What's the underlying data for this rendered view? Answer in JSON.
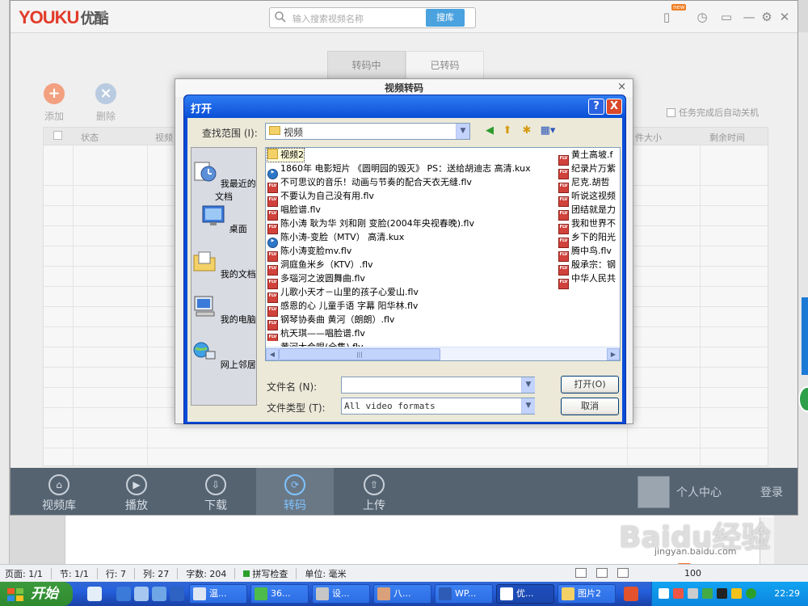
{
  "youku": {
    "logo": "YOUKU",
    "logo_cn": "优酷",
    "search_placeholder": "输入搜索视频名称",
    "search_button": "搜库",
    "tabs": [
      "转码中",
      "已转码"
    ],
    "toolbar": {
      "add": "添加",
      "delete": "删除"
    },
    "shutdown_option": "任务完成后自动关机",
    "table_headers": [
      "状态",
      "视频",
      "件大小",
      "剩余时间"
    ],
    "nav": [
      "视频库",
      "播放",
      "下载",
      "转码",
      "上传"
    ],
    "user_center": "个人中心",
    "login": "登录",
    "badge": "new"
  },
  "transcode_dialog": {
    "title": "视频转码",
    "close": "×"
  },
  "open_dialog": {
    "title": "打开",
    "help": "?",
    "close": "X",
    "lookin_label": "查找范围 (I):",
    "lookin_value": "视频",
    "places": [
      "我最近的文档",
      "桌面",
      "我的文档",
      "我的电脑",
      "网上邻居"
    ],
    "files_col1": [
      {
        "name": "视频2",
        "type": "folder"
      },
      {
        "name": "1860年 电影短片 《圆明园的毁灭》  PS：送给胡迪志 高清.kux",
        "type": "kux"
      },
      {
        "name": "不可思议的音乐！动画与节奏的配合天衣无缝.flv",
        "type": "flv"
      },
      {
        "name": "不要认为自己没有用.flv",
        "type": "flv"
      },
      {
        "name": "唱脸谱.flv",
        "type": "flv"
      },
      {
        "name": "陈小涛 耿为华 刘和刚 变脸(2004年央视春晚).flv",
        "type": "flv"
      },
      {
        "name": "陈小涛-变脸（MTV） 高清.kux",
        "type": "kux"
      },
      {
        "name": "陈小涛变脸mv.flv",
        "type": "flv"
      },
      {
        "name": "洞庭鱼米乡（KTV）.flv",
        "type": "flv"
      },
      {
        "name": "多瑙河之波圆舞曲.flv",
        "type": "flv"
      },
      {
        "name": "儿歌小天才－山里的孩子心爱山.flv",
        "type": "flv"
      },
      {
        "name": "感恩的心 儿童手语 字幕 阳华林.flv",
        "type": "flv"
      },
      {
        "name": "钢琴协奏曲 黄河（朗朗）.flv",
        "type": "flv"
      },
      {
        "name": "杭天琪——唱脸谱.flv",
        "type": "flv"
      },
      {
        "name": "黄河大合唱(全集).flv",
        "type": "flv"
      }
    ],
    "files_col2": [
      {
        "name": "黄土高坡.f",
        "type": "flv"
      },
      {
        "name": "纪录片万紫",
        "type": "flv"
      },
      {
        "name": "尼克.胡哲",
        "type": "flv"
      },
      {
        "name": "听说这视频",
        "type": "flv"
      },
      {
        "name": "团结就是力",
        "type": "flv"
      },
      {
        "name": "我和世界不",
        "type": "flv"
      },
      {
        "name": "乡下的阳光",
        "type": "flv"
      },
      {
        "name": "腾中鸟.flv",
        "type": "flv"
      },
      {
        "name": "殷承宗：钢",
        "type": "flv"
      },
      {
        "name": "中华人民共",
        "type": "flv"
      }
    ],
    "filename_label": "文件名 (N):",
    "filename_value": "",
    "filetype_label": "文件类型 (T):",
    "filetype_value": "All video formats",
    "open_button": "打开(O)",
    "cancel_button": "取消"
  },
  "status_bar": {
    "page": "页面: 1/1",
    "section": "节: 1/1",
    "line": "行: 7",
    "column": "列: 27",
    "word_count": "字数: 204",
    "spellcheck": "拼写检查",
    "unit": "单位: 毫米",
    "zoom": "100"
  },
  "ime": {
    "lang": "中"
  },
  "taskbar": {
    "start": "开始",
    "items": [
      "温...",
      "36...",
      "设...",
      "八...",
      "WP...",
      "优...",
      "图片2"
    ],
    "clock": "22:29"
  },
  "watermark": {
    "text": "Baidu经验",
    "url": "jingyan.baidu.com"
  }
}
